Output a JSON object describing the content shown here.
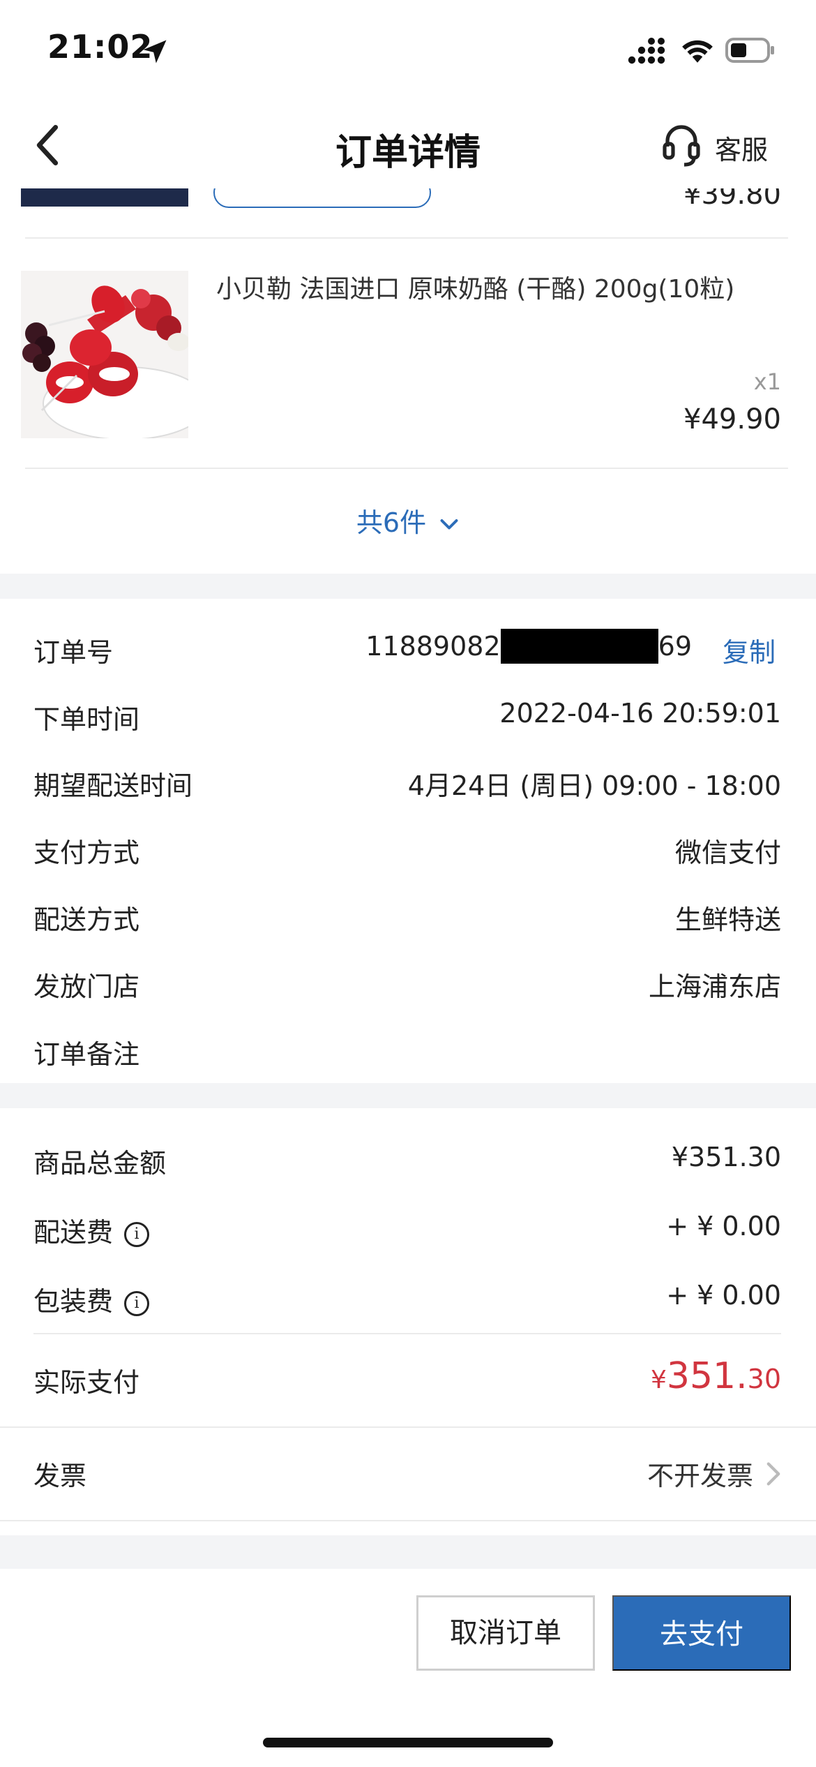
{
  "status_bar": {
    "time": "21:02"
  },
  "nav": {
    "title": "订单详情",
    "service_label": "客服"
  },
  "partial_item": {
    "price": "¥39.80"
  },
  "product": {
    "name": "小贝勒 法国进口 原味奶酪 (干酪) 200g(10粒)",
    "qty": "x1",
    "price": "¥49.90"
  },
  "items_summary": {
    "label": "共6件"
  },
  "order_info": {
    "order_no_label": "订单号",
    "order_no_prefix": "11889082",
    "order_no_suffix": "69",
    "copy_label": "复制",
    "time_label": "下单时间",
    "time_value": "2022-04-16 20:59:01",
    "expected_label": "期望配送时间",
    "expected_value": "4月24日 (周日) 09:00 - 18:00",
    "pay_method_label": "支付方式",
    "pay_method_value": "微信支付",
    "delivery_label": "配送方式",
    "delivery_value": "生鲜特送",
    "store_label": "发放门店",
    "store_value": "上海浦东店",
    "remark_label": "订单备注"
  },
  "amounts": {
    "goods_total_label": "商品总金额",
    "goods_total_value": "¥351.30",
    "delivery_fee_label": "配送费",
    "delivery_fee_value": "+ ¥ 0.00",
    "packing_fee_label": "包装费",
    "packing_fee_value": "+ ¥ 0.00",
    "actual_label": "实际支付",
    "actual_symbol": "¥",
    "actual_int": "351.",
    "actual_dec": "30"
  },
  "invoice": {
    "label": "发票",
    "value": "不开发票"
  },
  "actions": {
    "cancel_label": "取消订单",
    "pay_label": "去支付"
  },
  "colors": {
    "accent": "#2b6cb8",
    "price_red": "#d1353f",
    "section_bg": "#f3f4f6"
  }
}
